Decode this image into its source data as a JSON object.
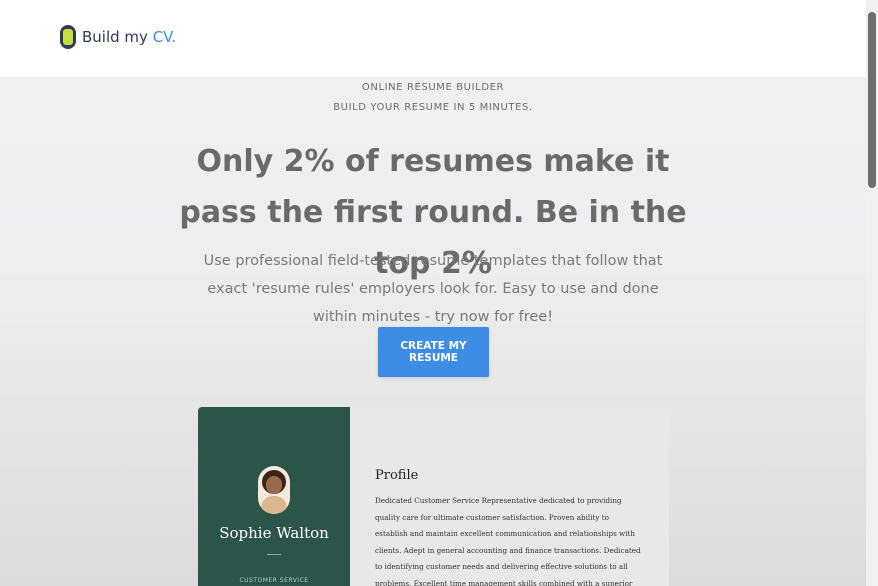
{
  "header": {
    "logo_text_main": "Build my",
    "logo_text_accent": "CV."
  },
  "hero": {
    "kicker_line1": "ONLINE RESUME BUILDER",
    "kicker_line2": "BUILD YOUR RESUME IN 5 MINUTES.",
    "headline": "Only 2% of resumes make it pass the first round. Be in the top 2%",
    "subtext": "Use professional field-tested resume templates that follow that exact 'resume rules' employers look for. Easy to use and done within minutes - try now for free!",
    "cta_label": "CREATE MY RESUME"
  },
  "resume_preview": {
    "name": "Sophie Walton",
    "role": "CUSTOMER SERVICE",
    "section_title": "Profile",
    "profile_text": "Dedicated Customer Service Representative dedicated to providing quality care for ultimate customer satisfaction. Proven ability to establish and maintain excellent communication and relationships with clients. Adept in general accounting and finance transactions. Dedicated to identifying customer needs and delivering effective solutions to all problems. Excellent time management skills combined with a superior knowledge of the customer service industry. Bilingual, hardworking, and"
  },
  "colors": {
    "accent": "#3d8ce6",
    "sidebar_green": "#2b5548",
    "logo_navy": "#2f3a56",
    "logo_lime": "#c7df3b"
  },
  "icons": {
    "logo": "cv-logo-icon"
  }
}
